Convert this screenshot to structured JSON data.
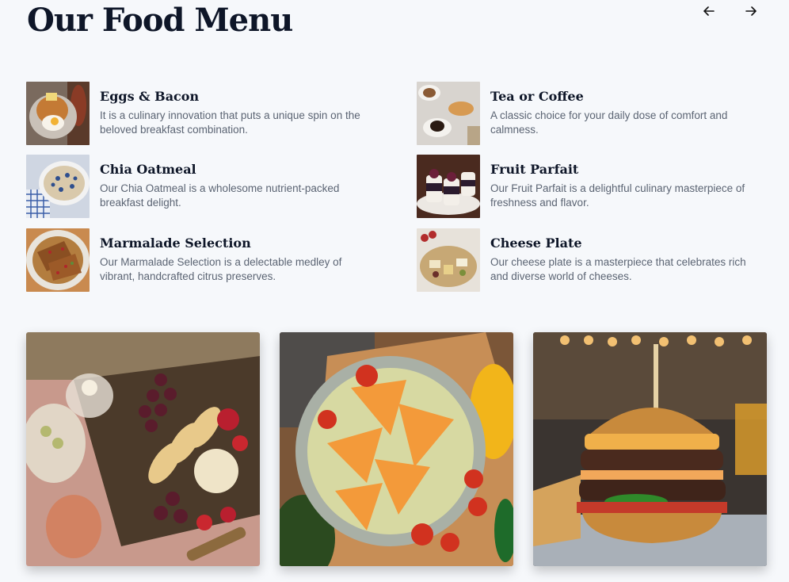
{
  "page": {
    "title": "Our Food Menu"
  },
  "carousel": {
    "prev_icon": "arrow-left-icon",
    "next_icon": "arrow-right-icon"
  },
  "menu": {
    "items": [
      {
        "name": "Eggs & Bacon",
        "description": "It is a culinary innovation that puts a unique spin on the beloved breakfast combination.",
        "image": "eggs-bacon-thumbnail"
      },
      {
        "name": "Tea or Coffee",
        "description": "A classic choice for your daily dose of comfort and calmness.",
        "image": "tea-coffee-thumbnail"
      },
      {
        "name": "Chia Oatmeal",
        "description": "Our Chia Oatmeal is a wholesome nutrient-packed breakfast delight.",
        "image": "chia-oatmeal-thumbnail"
      },
      {
        "name": "Fruit Parfait",
        "description": "Our Fruit Parfait is a delightful culinary masterpiece of freshness and flavor.",
        "image": "fruit-parfait-thumbnail"
      },
      {
        "name": "Marmalade Selection",
        "description": "Our Marmalade Selection is a delectable medley of vibrant, handcrafted citrus preserves.",
        "image": "marmalade-thumbnail"
      },
      {
        "name": "Cheese Plate",
        "description": "Our cheese plate is a masterpiece that celebrates rich and diverse world of cheeses.",
        "image": "cheese-plate-thumbnail"
      }
    ]
  },
  "gallery": {
    "photos": [
      {
        "image": "charcuterie-board-photo"
      },
      {
        "image": "nachos-bowl-photo"
      },
      {
        "image": "burger-photo"
      }
    ]
  },
  "colors": {
    "background": "#f6f8fb",
    "heading": "#0e1628",
    "body_text": "#5b6473"
  }
}
